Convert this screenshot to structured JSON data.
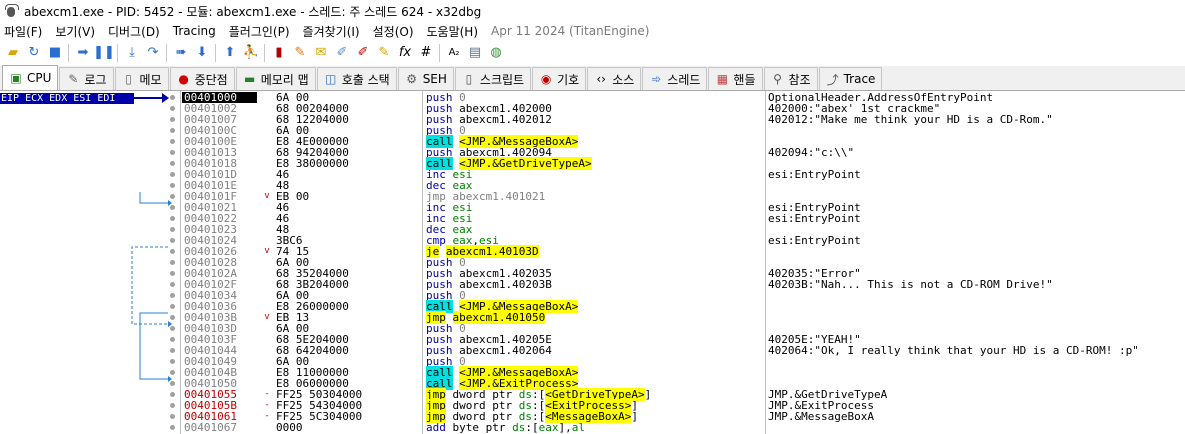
{
  "window": {
    "title": "abexcm1.exe - PID: 5452 - 모듈: abexcm1.exe - 스레드: 주 스레드 624 - x32dbg"
  },
  "menu": {
    "items": [
      "파일(F)",
      "보기(V)",
      "디버그(D)",
      "Tracing",
      "플러그인(P)",
      "즐겨찾기(I)",
      "설정(O)",
      "도움말(H)"
    ],
    "date": "Apr 11 2024 (TitanEngine)"
  },
  "toolbar": {
    "icons": [
      "open-icon",
      "restart-icon",
      "stop-icon",
      "run-icon",
      "pause-icon",
      "step-into-icon",
      "step-over-icon",
      "trace-into-icon",
      "trace-over-icon",
      "execute-till-return-icon",
      "run-to-user-code-icon",
      "scylla-icon",
      "patch-icon",
      "comment-icon",
      "label-icon",
      "bookmark-icon",
      "function-icon",
      "fx-icon",
      "hash-icon",
      "font-icon",
      "calculator-icon",
      "globe-icon"
    ]
  },
  "tabs": [
    {
      "label": "CPU",
      "icon": "cpu-icon"
    },
    {
      "label": "로그",
      "icon": "log-icon"
    },
    {
      "label": "메모",
      "icon": "notes-icon"
    },
    {
      "label": "중단점",
      "icon": "breakpoint-icon"
    },
    {
      "label": "메모리 맵",
      "icon": "memory-map-icon"
    },
    {
      "label": "호출 스택",
      "icon": "call-stack-icon"
    },
    {
      "label": "SEH",
      "icon": "seh-icon"
    },
    {
      "label": "스크립트",
      "icon": "script-icon"
    },
    {
      "label": "기호",
      "icon": "symbols-icon"
    },
    {
      "label": "소스",
      "icon": "source-icon"
    },
    {
      "label": "스레드",
      "icon": "threads-icon"
    },
    {
      "label": "핸들",
      "icon": "handles-icon"
    },
    {
      "label": "참조",
      "icon": "references-icon"
    },
    {
      "label": "Trace",
      "icon": "trace-icon"
    }
  ],
  "registers_label": "EIP ECX EDX ESI EDI",
  "disasm": [
    {
      "addr": "00401000",
      "jm": "",
      "bytes": "6A 00",
      "mn": "push",
      "ops": "0",
      "cmt": "OptionalHeader.AddressOfEntryPoint",
      "style": "cur"
    },
    {
      "addr": "00401002",
      "jm": "",
      "bytes": "68 00204000",
      "mn": "push",
      "ops": "abexcm1.402000",
      "cmt": "402000:\"abex' 1st crackme\""
    },
    {
      "addr": "00401007",
      "jm": "",
      "bytes": "68 12204000",
      "mn": "push",
      "ops": "abexcm1.402012",
      "cmt": "402012:\"Make me think your HD is a CD-Rom.\""
    },
    {
      "addr": "0040100C",
      "jm": "",
      "bytes": "6A 00",
      "mn": "push",
      "ops": "0",
      "cmt": ""
    },
    {
      "addr": "0040100E",
      "jm": "",
      "bytes": "E8 4E000000",
      "mn": "call",
      "ops": "<JMP.&MessageBoxA>",
      "cmt": ""
    },
    {
      "addr": "00401013",
      "jm": "",
      "bytes": "68 94204000",
      "mn": "push",
      "ops": "abexcm1.402094",
      "cmt": "402094:\"c:\\\\\""
    },
    {
      "addr": "00401018",
      "jm": "",
      "bytes": "E8 38000000",
      "mn": "call",
      "ops": "<JMP.&GetDriveTypeA>",
      "cmt": ""
    },
    {
      "addr": "0040101D",
      "jm": "",
      "bytes": "46",
      "mn": "inc",
      "ops": "esi",
      "cmt": "esi:EntryPoint"
    },
    {
      "addr": "0040101E",
      "jm": "",
      "bytes": "48",
      "mn": "dec",
      "ops": "eax",
      "cmt": ""
    },
    {
      "addr": "0040101F",
      "jm": "v",
      "bytes": "EB 00",
      "mn": "jmp",
      "ops": "abexcm1.401021",
      "cmt": ""
    },
    {
      "addr": "00401021",
      "jm": "",
      "bytes": "46",
      "mn": "inc",
      "ops": "esi",
      "cmt": "esi:EntryPoint"
    },
    {
      "addr": "00401022",
      "jm": "",
      "bytes": "46",
      "mn": "inc",
      "ops": "esi",
      "cmt": "esi:EntryPoint"
    },
    {
      "addr": "00401023",
      "jm": "",
      "bytes": "48",
      "mn": "dec",
      "ops": "eax",
      "cmt": ""
    },
    {
      "addr": "00401024",
      "jm": "",
      "bytes": "3BC6",
      "mn": "cmp",
      "ops": "eax,esi",
      "cmt": "esi:EntryPoint"
    },
    {
      "addr": "00401026",
      "jm": "v",
      "bytes": "74 15",
      "mn": "je",
      "ops": "abexcm1.40103D",
      "cmt": ""
    },
    {
      "addr": "00401028",
      "jm": "",
      "bytes": "6A 00",
      "mn": "push",
      "ops": "0",
      "cmt": ""
    },
    {
      "addr": "0040102A",
      "jm": "",
      "bytes": "68 35204000",
      "mn": "push",
      "ops": "abexcm1.402035",
      "cmt": "402035:\"Error\""
    },
    {
      "addr": "0040102F",
      "jm": "",
      "bytes": "68 3B204000",
      "mn": "push",
      "ops": "abexcm1.40203B",
      "cmt": "40203B:\"Nah... This is not a CD-ROM Drive!\""
    },
    {
      "addr": "00401034",
      "jm": "",
      "bytes": "6A 00",
      "mn": "push",
      "ops": "0",
      "cmt": ""
    },
    {
      "addr": "00401036",
      "jm": "",
      "bytes": "E8 26000000",
      "mn": "call",
      "ops": "<JMP.&MessageBoxA>",
      "cmt": ""
    },
    {
      "addr": "0040103B",
      "jm": "v",
      "bytes": "EB 13",
      "mn": "jmp",
      "ops": "abexcm1.401050",
      "cmt": ""
    },
    {
      "addr": "0040103D",
      "jm": "",
      "bytes": "6A 00",
      "mn": "push",
      "ops": "0",
      "cmt": ""
    },
    {
      "addr": "0040103F",
      "jm": "",
      "bytes": "68 5E204000",
      "mn": "push",
      "ops": "abexcm1.40205E",
      "cmt": "40205E:\"YEAH!\""
    },
    {
      "addr": "00401044",
      "jm": "",
      "bytes": "68 64204000",
      "mn": "push",
      "ops": "abexcm1.402064",
      "cmt": "402064:\"Ok, I really think that your HD is a CD-ROM! :p\""
    },
    {
      "addr": "00401049",
      "jm": "",
      "bytes": "6A 00",
      "mn": "push",
      "ops": "0",
      "cmt": ""
    },
    {
      "addr": "0040104B",
      "jm": "",
      "bytes": "E8 11000000",
      "mn": "call",
      "ops": "<JMP.&MessageBoxA>",
      "cmt": ""
    },
    {
      "addr": "00401050",
      "jm": "",
      "bytes": "E8 06000000",
      "mn": "call",
      "ops": "<JMP.&ExitProcess>",
      "cmt": ""
    },
    {
      "addr": "00401055",
      "jm": "-",
      "bytes": "FF25 50304000",
      "mn": "jmp",
      "ops": "dword ptr ds:[<GetDriveTypeA>]",
      "cmt": "JMP.&GetDriveTypeA",
      "style": "red"
    },
    {
      "addr": "0040105B",
      "jm": "-",
      "bytes": "FF25 54304000",
      "mn": "jmp",
      "ops": "dword ptr ds:[<ExitProcess>]",
      "cmt": "JMP.&ExitProcess",
      "style": "red"
    },
    {
      "addr": "00401061",
      "jm": "-",
      "bytes": "FF25 5C304000",
      "mn": "jmp",
      "ops": "dword ptr ds:[<MessageBoxA>]",
      "cmt": "JMP.&MessageBoxA",
      "style": "red"
    },
    {
      "addr": "00401067",
      "jm": "",
      "bytes": "0000",
      "mn": "add",
      "ops": "byte ptr ds:[eax],al",
      "cmt": ""
    }
  ]
}
